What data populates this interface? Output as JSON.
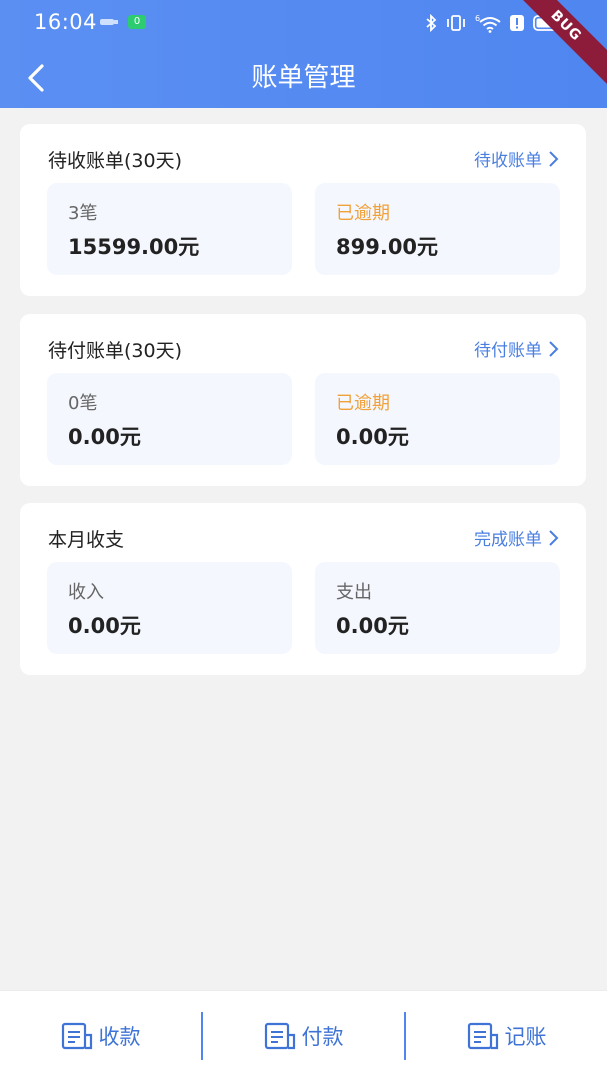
{
  "status_bar": {
    "time": "16:04",
    "battery_saver_badge": "0",
    "icons": [
      "usb-icon",
      "bluetooth-icon",
      "vibrate-icon",
      "signal-5g-icon",
      "wifi-icon",
      "alert-icon",
      "battery-icon"
    ]
  },
  "debug_banner": "BUG",
  "nav": {
    "back_icon": "chevron-left-icon",
    "title": "账单管理"
  },
  "cards": {
    "receivable": {
      "title": "待收账单(30天)",
      "link": "待收账单",
      "count_label": "3笔",
      "amount": "15599.00元",
      "overdue_label": "已逾期",
      "overdue_amount": "899.00元"
    },
    "payable": {
      "title": "待付账单(30天)",
      "link": "待付账单",
      "count_label": "0笔",
      "amount": "0.00元",
      "overdue_label": "已逾期",
      "overdue_amount": "0.00元"
    },
    "monthly": {
      "title": "本月收支",
      "link": "完成账单",
      "income_label": "收入",
      "income_amount": "0.00元",
      "expense_label": "支出",
      "expense_amount": "0.00元"
    }
  },
  "bottom_bar": {
    "receive": "收款",
    "pay": "付款",
    "record": "记账"
  },
  "colors": {
    "primary": "#4f86f0",
    "link": "#4a7fe0",
    "warning": "#f0a13a",
    "background": "#f2f2f2",
    "stat_box": "#f4f7fd"
  }
}
